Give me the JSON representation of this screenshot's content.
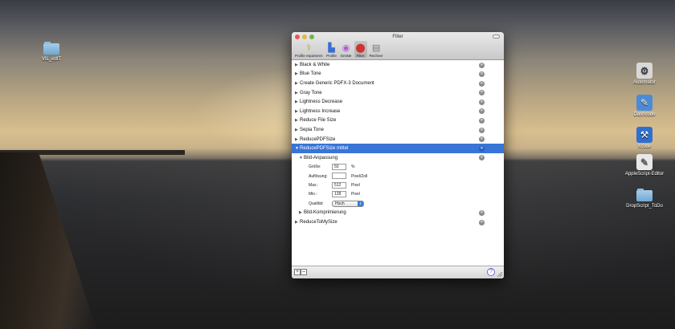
{
  "desktop": {
    "icons": [
      {
        "label": "VIL_edIT",
        "kind": "folder"
      },
      {
        "label": "Automator",
        "kind": "app"
      },
      {
        "label": "Dashcode",
        "kind": "app"
      },
      {
        "label": "Xcode",
        "kind": "app"
      },
      {
        "label": "AppleScript-Editor",
        "kind": "app"
      },
      {
        "label": "DropScript_ToDo",
        "kind": "folder"
      }
    ]
  },
  "window": {
    "title": "Filter",
    "toolbar": [
      {
        "label": "Profile reparieren",
        "icon": "repair-icon"
      },
      {
        "label": "Profile",
        "icon": "profile-icon"
      },
      {
        "label": "Geräte",
        "icon": "devices-icon"
      },
      {
        "label": "Filter",
        "icon": "filter-icon",
        "active": true
      },
      {
        "label": "Rechner",
        "icon": "calculator-icon"
      }
    ],
    "filters": [
      {
        "label": "Black & White",
        "expanded": false
      },
      {
        "label": "Blue Tone",
        "expanded": false
      },
      {
        "label": "Create Generic PDFX-3 Document",
        "expanded": false
      },
      {
        "label": "Gray Tone",
        "expanded": false
      },
      {
        "label": "Lightness Decrease",
        "expanded": false
      },
      {
        "label": "Lightness Increase",
        "expanded": false
      },
      {
        "label": "Reduce File Size",
        "expanded": false
      },
      {
        "label": "Sepia Tone",
        "expanded": false
      },
      {
        "label": "ReducePDFSize",
        "expanded": false
      },
      {
        "label": "ReducePDFSize mittel",
        "expanded": true,
        "selected": true
      }
    ],
    "expanded_filter": {
      "section_label": "Bild-Anpassung",
      "params": {
        "groesse_label": "Größe:",
        "groesse_value": "50",
        "groesse_unit": "%",
        "aufloesung_label": "Auflösung:",
        "aufloesung_value": "",
        "aufloesung_unit": "Pixel/Zoll",
        "max_label": "Max.:",
        "max_value": "512",
        "max_unit": "Pixel",
        "min_label": "Min.:",
        "min_value": "128",
        "min_unit": "Pixel",
        "qualitaet_label": "Qualität:",
        "qualitaet_value": "Hoch"
      },
      "second_section_label": "Bild-Komprimierung"
    },
    "last_filter": "ReduceToMySize",
    "badge_glyph": "✕",
    "bottom": {
      "add": "+",
      "remove": "–",
      "help": "?"
    }
  }
}
